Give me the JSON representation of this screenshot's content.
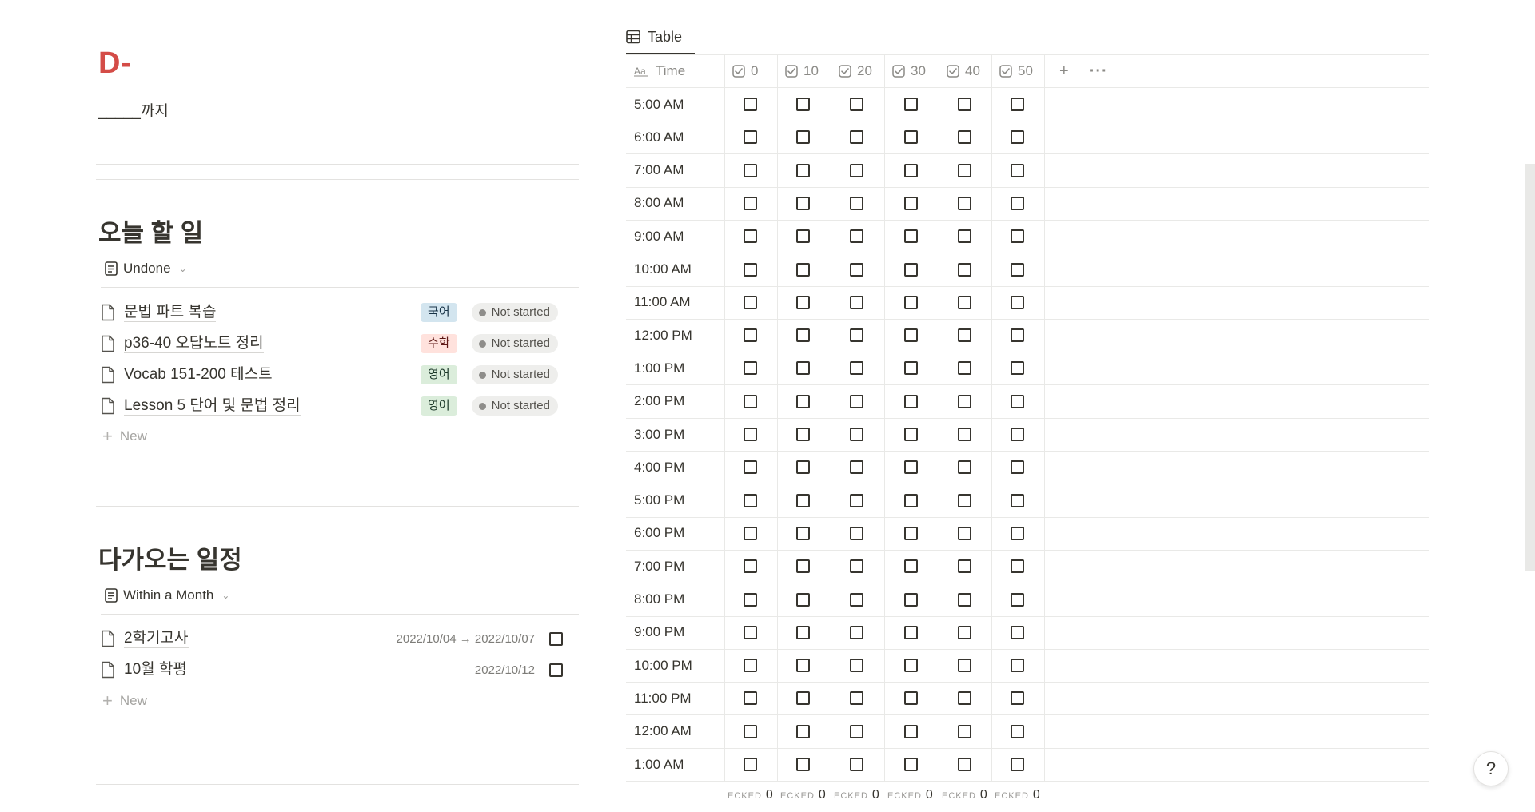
{
  "page": {
    "title": "D-",
    "until": "_____까지"
  },
  "today": {
    "heading": "오늘 할 일",
    "view_label": "Undone",
    "items": [
      {
        "title": "문법 파트 복습",
        "tag": "국어",
        "tag_color": "#d3e5ef",
        "tag_text_color": "#183347",
        "status": "Not started"
      },
      {
        "title": "p36-40 오답노트 정리",
        "tag": "수학",
        "tag_color": "#ffe2dd",
        "tag_text_color": "#5d1715",
        "status": "Not started"
      },
      {
        "title": "Vocab 151-200 테스트",
        "tag": "영어",
        "tag_color": "#dbeddb",
        "tag_text_color": "#1c3829",
        "status": "Not started"
      },
      {
        "title": "Lesson 5 단어 및 문법 정리",
        "tag": "영어",
        "tag_color": "#dbeddb",
        "tag_text_color": "#1c3829",
        "status": "Not started"
      }
    ],
    "new_label": "New"
  },
  "upcoming": {
    "heading": "다가오는 일정",
    "view_label": "Within a Month",
    "items": [
      {
        "title": "2학기고사",
        "date": "2022/10/04 → 2022/10/07",
        "checked": false
      },
      {
        "title": "10월 학평",
        "date": "2022/10/12",
        "checked": false
      }
    ],
    "new_label": "New"
  },
  "table": {
    "tab_label": "Table",
    "time_header": "Time",
    "columns": [
      "0",
      "10",
      "20",
      "30",
      "40",
      "50"
    ],
    "rows": [
      "5:00 AM",
      "6:00 AM",
      "7:00 AM",
      "8:00 AM",
      "9:00 AM",
      "10:00 AM",
      "11:00 AM",
      "12:00 PM",
      "1:00 PM",
      "2:00 PM",
      "3:00 PM",
      "4:00 PM",
      "5:00 PM",
      "6:00 PM",
      "7:00 PM",
      "8:00 PM",
      "9:00 PM",
      "10:00 PM",
      "11:00 PM",
      "12:00 AM",
      "1:00 AM"
    ],
    "footer_label": "ECKED",
    "footer_values": [
      "0",
      "0",
      "0",
      "0",
      "0",
      "0"
    ],
    "add_icon": "plus-icon",
    "more_icon": "more-icon"
  },
  "help_label": "?"
}
